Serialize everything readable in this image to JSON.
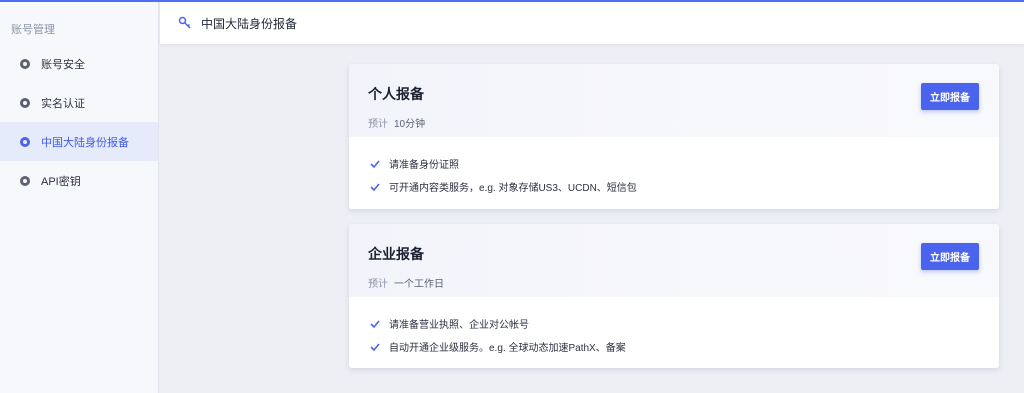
{
  "sidebar": {
    "title": "账号管理",
    "items": [
      {
        "label": "账号安全",
        "icon": "shield-icon"
      },
      {
        "label": "实名认证",
        "icon": "shield-icon"
      },
      {
        "label": "中国大陆身份报备",
        "icon": "shield-icon"
      },
      {
        "label": "API密钥",
        "icon": "shield-icon"
      }
    ]
  },
  "header": {
    "icon": "key-icon",
    "title": "中国大陆身份报备"
  },
  "cards": [
    {
      "title": "个人报备",
      "est_label": "预计",
      "est_value": "10分钟",
      "button": "立即报备",
      "features": [
        "请准备身份证照",
        "可开通内容类服务，e.g. 对象存储US3、UCDN、短信包"
      ]
    },
    {
      "title": "企业报备",
      "est_label": "预计",
      "est_value": "一个工作日",
      "button": "立即报备",
      "features": [
        "请准备营业执照、企业对公帐号",
        "自动开通企业级服务。e.g. 全球动态加速PathX、备案"
      ]
    }
  ],
  "colors": {
    "accent": "#4a64ee",
    "active_bg": "#e6ebfb"
  }
}
